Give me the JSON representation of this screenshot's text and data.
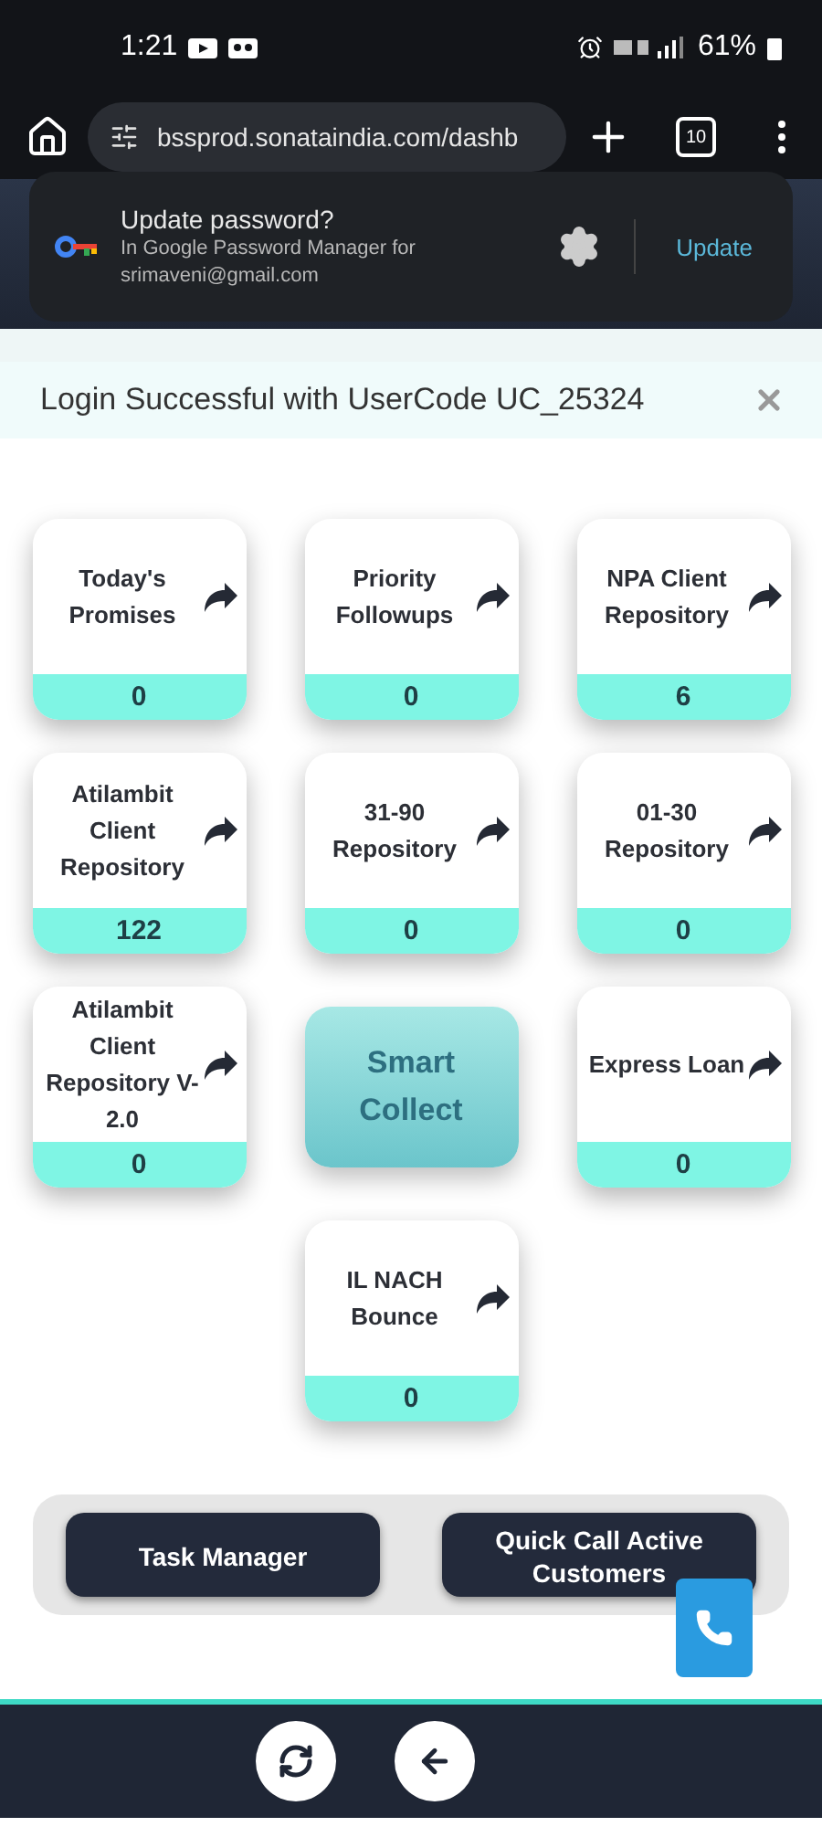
{
  "status_bar": {
    "time": "1:21",
    "battery": "61%"
  },
  "browser": {
    "url": "bssprod.sonataindia.com/dashb",
    "tab_count": "10"
  },
  "password_prompt": {
    "title": "Update password?",
    "subtitle": "In Google Password Manager for",
    "account": "srimaveni@gmail.com",
    "action": "Update"
  },
  "banner": {
    "message": "Login Successful with UserCode UC_25324"
  },
  "tiles": [
    {
      "kind": "counter",
      "label": "Today's Promises",
      "count": "0"
    },
    {
      "kind": "counter",
      "label": "Priority Followups",
      "count": "0"
    },
    {
      "kind": "counter",
      "label": "NPA Client Repository",
      "count": "6"
    },
    {
      "kind": "counter",
      "label": "Atilambit Client Repository",
      "count": "122"
    },
    {
      "kind": "counter",
      "label": "31-90 Repository",
      "count": "0"
    },
    {
      "kind": "counter",
      "label": "01-30 Repository",
      "count": "0"
    },
    {
      "kind": "counter",
      "label": "Atilambit Client Repository V-2.0",
      "count": "0"
    },
    {
      "kind": "action",
      "label": "Smart Collect"
    },
    {
      "kind": "counter",
      "label": "Express Loan",
      "count": "0"
    },
    {
      "kind": "counter",
      "label": "IL NACH Bounce",
      "count": "0"
    }
  ],
  "actions": [
    "Task Manager",
    "Quick Call Active Customers"
  ]
}
